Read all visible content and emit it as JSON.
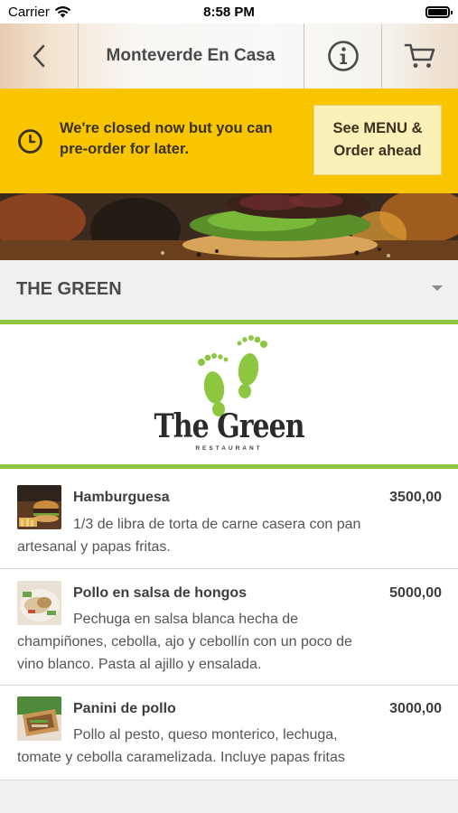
{
  "status_bar": {
    "carrier": "Carrier",
    "time": "8:58 PM",
    "icons": [
      "wifi-icon",
      "battery-icon"
    ]
  },
  "nav": {
    "title": "Monteverde En Casa",
    "icons": [
      "chevron-left-icon",
      "info-icon",
      "cart-icon"
    ]
  },
  "banner": {
    "message": "We're closed now but you can pre-order for later.",
    "button_label": "See MENU & Order ahead",
    "icon": "clock-icon",
    "color": "#f8c500"
  },
  "selector": {
    "selected": "THE GREEN",
    "icon": "caret-down-icon"
  },
  "logo": {
    "name": "The Green",
    "subtitle": "RESTAURANT",
    "accent": "#8dc63f"
  },
  "menu": {
    "items": [
      {
        "name": "Hamburguesa",
        "price": "3500,00",
        "description": "1/3 de libra de torta de carne casera con pan artesanal y papas fritas."
      },
      {
        "name": "Pollo en salsa de hongos",
        "price": "5000,00",
        "description": "Pechuga en salsa blanca hecha de champiñones, cebolla, ajo y cebollín con un poco de vino blanco. Pasta al ajillo y ensalada."
      },
      {
        "name": "Panini de pollo",
        "price": "3000,00",
        "description": "Pollo al pesto, queso monterico, lechuga, tomate y cebolla caramelizada. Incluye papas fritas"
      }
    ]
  }
}
